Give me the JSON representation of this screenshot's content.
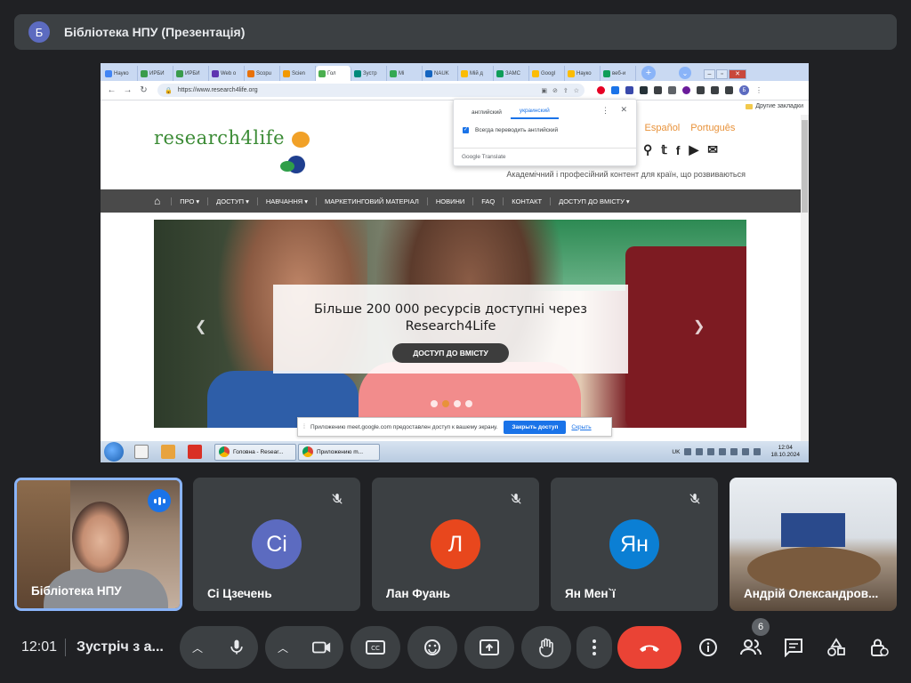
{
  "presenter_banner": {
    "avatar_letter": "Б",
    "title": "Бібліотека НПУ (Презентація)"
  },
  "browser": {
    "tabs": [
      {
        "label": "Науко",
        "color": "#4285f4"
      },
      {
        "label": "ИРБИ",
        "color": "#3a9b4c"
      },
      {
        "label": "ИРБИ",
        "color": "#3a9b4c"
      },
      {
        "label": "Web o",
        "color": "#5e35b1"
      },
      {
        "label": "Scopu",
        "color": "#e8710a"
      },
      {
        "label": "Scien",
        "color": "#f29900"
      },
      {
        "label": "Гол",
        "color": "#4caf50"
      },
      {
        "label": "Зустр",
        "color": "#00897b"
      },
      {
        "label": "Мі",
        "color": "#34a853"
      },
      {
        "label": "NAUK",
        "color": "#1565c0"
      },
      {
        "label": "Мій д",
        "color": "#fbbc04"
      },
      {
        "label": "ЗАМС",
        "color": "#0f9d58"
      },
      {
        "label": "Googl",
        "color": "#fbbc04"
      },
      {
        "label": "Науко",
        "color": "#fbbc04"
      },
      {
        "label": "веб-и",
        "color": "#0f9d58"
      }
    ],
    "url": "https://www.research4life.org",
    "bookmarks_other": "Другие закладки"
  },
  "translate_popup": {
    "tab_source": "английский",
    "tab_target": "украинский",
    "checkbox_label": "Всегда переводить английский",
    "footer": "Google Translate"
  },
  "site": {
    "logo": "research4life",
    "languages": [
      "s",
      "Español",
      "Português"
    ],
    "tagline": "Академічний і професійний контент для країн, що розвиваються",
    "menu": [
      "ПРО ▾",
      "ДОСТУП ▾",
      "НАВЧАННЯ ▾",
      "МАРКЕТИНГОВИЙ МАТЕРІАЛ",
      "НОВИНИ",
      "FAQ",
      "КОНТАКТ",
      "ДОСТУП ДО ВМІСТУ ▾"
    ],
    "slide_caption": "Більше 200 000 ресурсів доступні через Research4Life",
    "slide_button": "ДОСТУП ДО ВМІСТУ"
  },
  "share_notice": {
    "text": "Приложению meet.google.com предоставлен доступ к вашему экрану.",
    "stop_label": "Закрыть доступ",
    "hide_label": "Скрыть"
  },
  "taskbar": {
    "windows": [
      "Головна - Resear...",
      "Приложению m..."
    ],
    "lang": "UK",
    "time": "12:04",
    "date": "18.10.2024"
  },
  "participants": [
    {
      "name": "Бібліотека НПУ",
      "status": "speaking"
    },
    {
      "name": "Сі Цзечень",
      "initials": "Сі",
      "color": "#5c6bc0",
      "status": "muted"
    },
    {
      "name": "Лан Фуань",
      "initials": "Л",
      "color": "#e8471d",
      "status": "muted"
    },
    {
      "name": "Ян Мен`ї",
      "initials": "Ян",
      "color": "#0b7fd4",
      "status": "muted"
    },
    {
      "name": "Андрій Олександров...",
      "status": "video"
    }
  ],
  "meeting": {
    "time": "12:01",
    "title": "Зустріч з а...",
    "participants_count": "6"
  },
  "icons": [
    "mic-icon",
    "camera-icon",
    "captions-icon",
    "emoji-icon",
    "present-icon",
    "hand-icon",
    "more-icon",
    "end-call-icon",
    "info-icon",
    "people-icon",
    "chat-icon",
    "activities-icon",
    "host-controls-icon"
  ]
}
